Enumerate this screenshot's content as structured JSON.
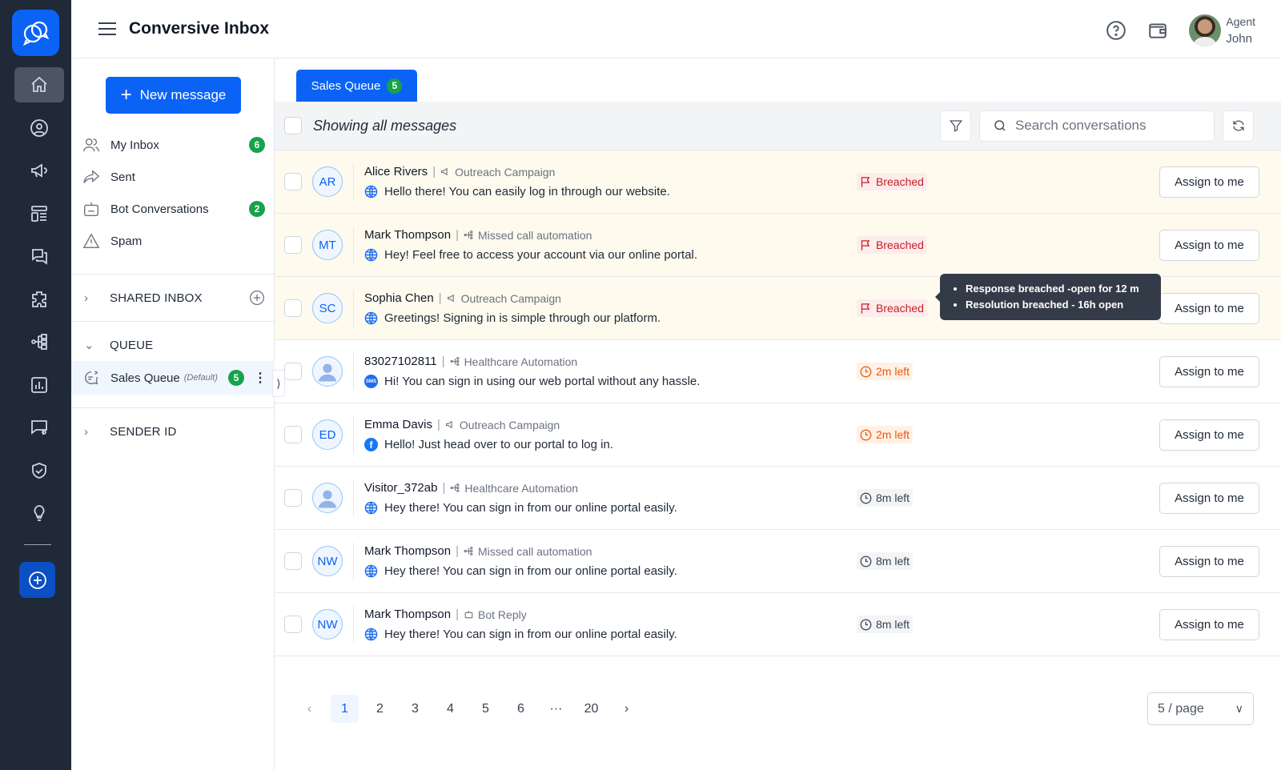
{
  "app": {
    "title": "Conversive Inbox"
  },
  "rail": {
    "items": [
      "home-icon",
      "user-circle-icon",
      "megaphone-icon",
      "layout-icon",
      "chat-icon",
      "puzzle-icon",
      "flow-icon",
      "chart-icon",
      "chat-settings-icon",
      "shield-check-icon",
      "lightbulb-icon"
    ],
    "active": "home-icon"
  },
  "header": {
    "agent_role": "Agent",
    "agent_name": "John"
  },
  "sidebar": {
    "new_message": "New message",
    "items": [
      {
        "label": "My Inbox",
        "count": "6",
        "icon": "users-icon"
      },
      {
        "label": "Sent",
        "icon": "send-icon"
      },
      {
        "label": "Bot Conversations",
        "count": "2",
        "icon": "bot-icon"
      },
      {
        "label": "Spam",
        "icon": "warning-icon"
      }
    ],
    "shared_inbox": "SHARED INBOX",
    "queue": "QUEUE",
    "queue_item": {
      "label": "Sales Queue",
      "tag": "(Default)",
      "count": "5"
    },
    "sender_id": "SENDER ID"
  },
  "main": {
    "tab": {
      "label": "Sales Queue",
      "count": "5"
    },
    "showing": "Showing all messages",
    "search_placeholder": "Search conversations",
    "assign_label": "Assign to me",
    "tooltip": [
      "Response breached -open for 12 m",
      "Resolution breached - 16h open"
    ],
    "rows": [
      {
        "initials": "AR",
        "name": "Alice Rivers",
        "source": "Outreach Campaign",
        "source_icon": "megaphone",
        "channel": "web",
        "message": "Hello there! You can easily log in through our website.",
        "status": "Breached",
        "type": "breached"
      },
      {
        "initials": "MT",
        "name": "Mark Thompson",
        "source": "Missed call automation",
        "source_icon": "flow",
        "channel": "web",
        "message": "Hey! Feel free to access your account via our online portal.",
        "status": "Breached",
        "type": "breached"
      },
      {
        "initials": "SC",
        "name": "Sophia Chen",
        "source": "Outreach Campaign",
        "source_icon": "megaphone",
        "channel": "web",
        "message": "Greetings! Signing in is simple through our platform.",
        "status": "Breached",
        "type": "breached"
      },
      {
        "initials": "",
        "name": "83027102811",
        "source": "Healthcare Automation",
        "source_icon": "flow",
        "channel": "sms",
        "message": "Hi! You can sign in using our web portal without any hassle.",
        "status": "2m left",
        "type": "warn"
      },
      {
        "initials": "ED",
        "name": "Emma Davis",
        "source": "Outreach Campaign",
        "source_icon": "megaphone",
        "channel": "facebook",
        "message": "Hello! Just head over to our portal to log in.",
        "status": "2m left",
        "type": "warn"
      },
      {
        "initials": "",
        "name": "Visitor_372ab",
        "source": "Healthcare Automation",
        "source_icon": "flow",
        "channel": "web",
        "message": "Hey there! You can sign in from our online portal easily.",
        "status": "8m left",
        "type": "ok"
      },
      {
        "initials": "NW",
        "name": "Mark Thompson",
        "source": "Missed call automation",
        "source_icon": "flow",
        "channel": "web",
        "message": "Hey there! You can sign in from our online portal easily.",
        "status": "8m left",
        "type": "ok"
      },
      {
        "initials": "NW",
        "name": "Mark Thompson",
        "source": "Bot Reply",
        "source_icon": "bot",
        "channel": "web",
        "message": "Hey there! You can sign in from our online portal easily.",
        "status": "8m left",
        "type": "ok"
      }
    ],
    "pagination": {
      "pages": [
        "1",
        "2",
        "3",
        "4",
        "5",
        "6",
        "···",
        "20"
      ],
      "current": "1",
      "per_page": "5 / page"
    }
  },
  "colors": {
    "primary": "#0b63f6",
    "rail": "#1f2937",
    "breached": "#c81e1e",
    "warning": "#ea580c",
    "badge": "#16a34a",
    "breached_row": "#fefaee"
  }
}
